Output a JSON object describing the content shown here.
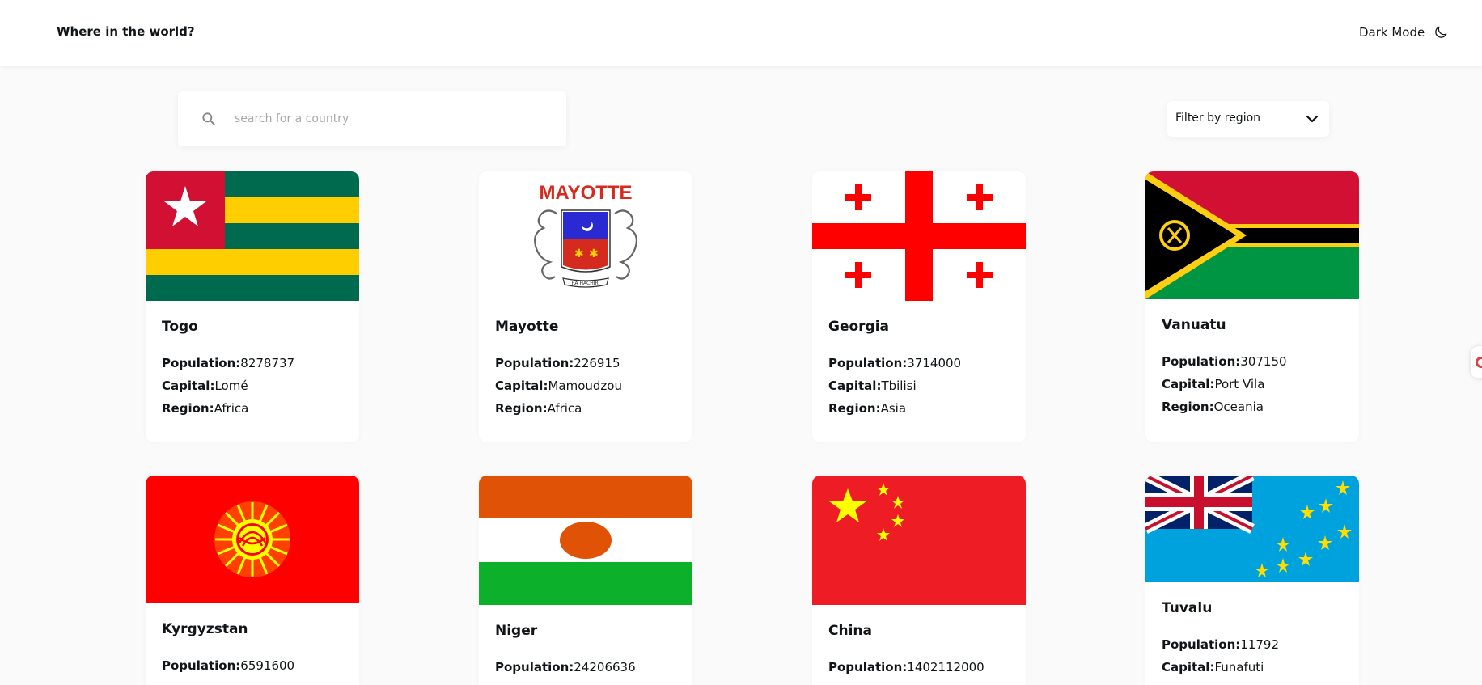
{
  "header": {
    "title": "Where in the world?",
    "dark_mode_label": "Dark Mode",
    "dark_mode_icon": "moon-icon"
  },
  "search": {
    "placeholder": "search for a country",
    "value": "",
    "icon": "search-icon"
  },
  "filter": {
    "label": "Filter by region",
    "icon": "chevron-down-icon"
  },
  "labels": {
    "population": "Population:",
    "capital": "Capital:",
    "region": "Region:"
  },
  "countries": [
    {
      "name": "Togo",
      "population": "8278737",
      "capital": "Lomé",
      "region": "Africa"
    },
    {
      "name": "Mayotte",
      "population": "226915",
      "capital": "Mamoudzou",
      "region": "Africa",
      "flag_text": "MAYOTTE",
      "flag_scroll_text": "RA HACHIRI"
    },
    {
      "name": "Georgia",
      "population": "3714000",
      "capital": "Tbilisi",
      "region": "Asia"
    },
    {
      "name": "Vanuatu",
      "population": "307150",
      "capital": "Port Vila",
      "region": "Oceania"
    },
    {
      "name": "Kyrgyzstan",
      "population": "6591600"
    },
    {
      "name": "Niger",
      "population": "24206636"
    },
    {
      "name": "China",
      "population": "1402112000"
    },
    {
      "name": "Tuvalu",
      "population": "11792",
      "capital": "Funafuti"
    }
  ],
  "colors": {
    "background": "#fafafa",
    "card": "#ffffff",
    "text": "#111517",
    "placeholder": "#a8a8a8"
  }
}
